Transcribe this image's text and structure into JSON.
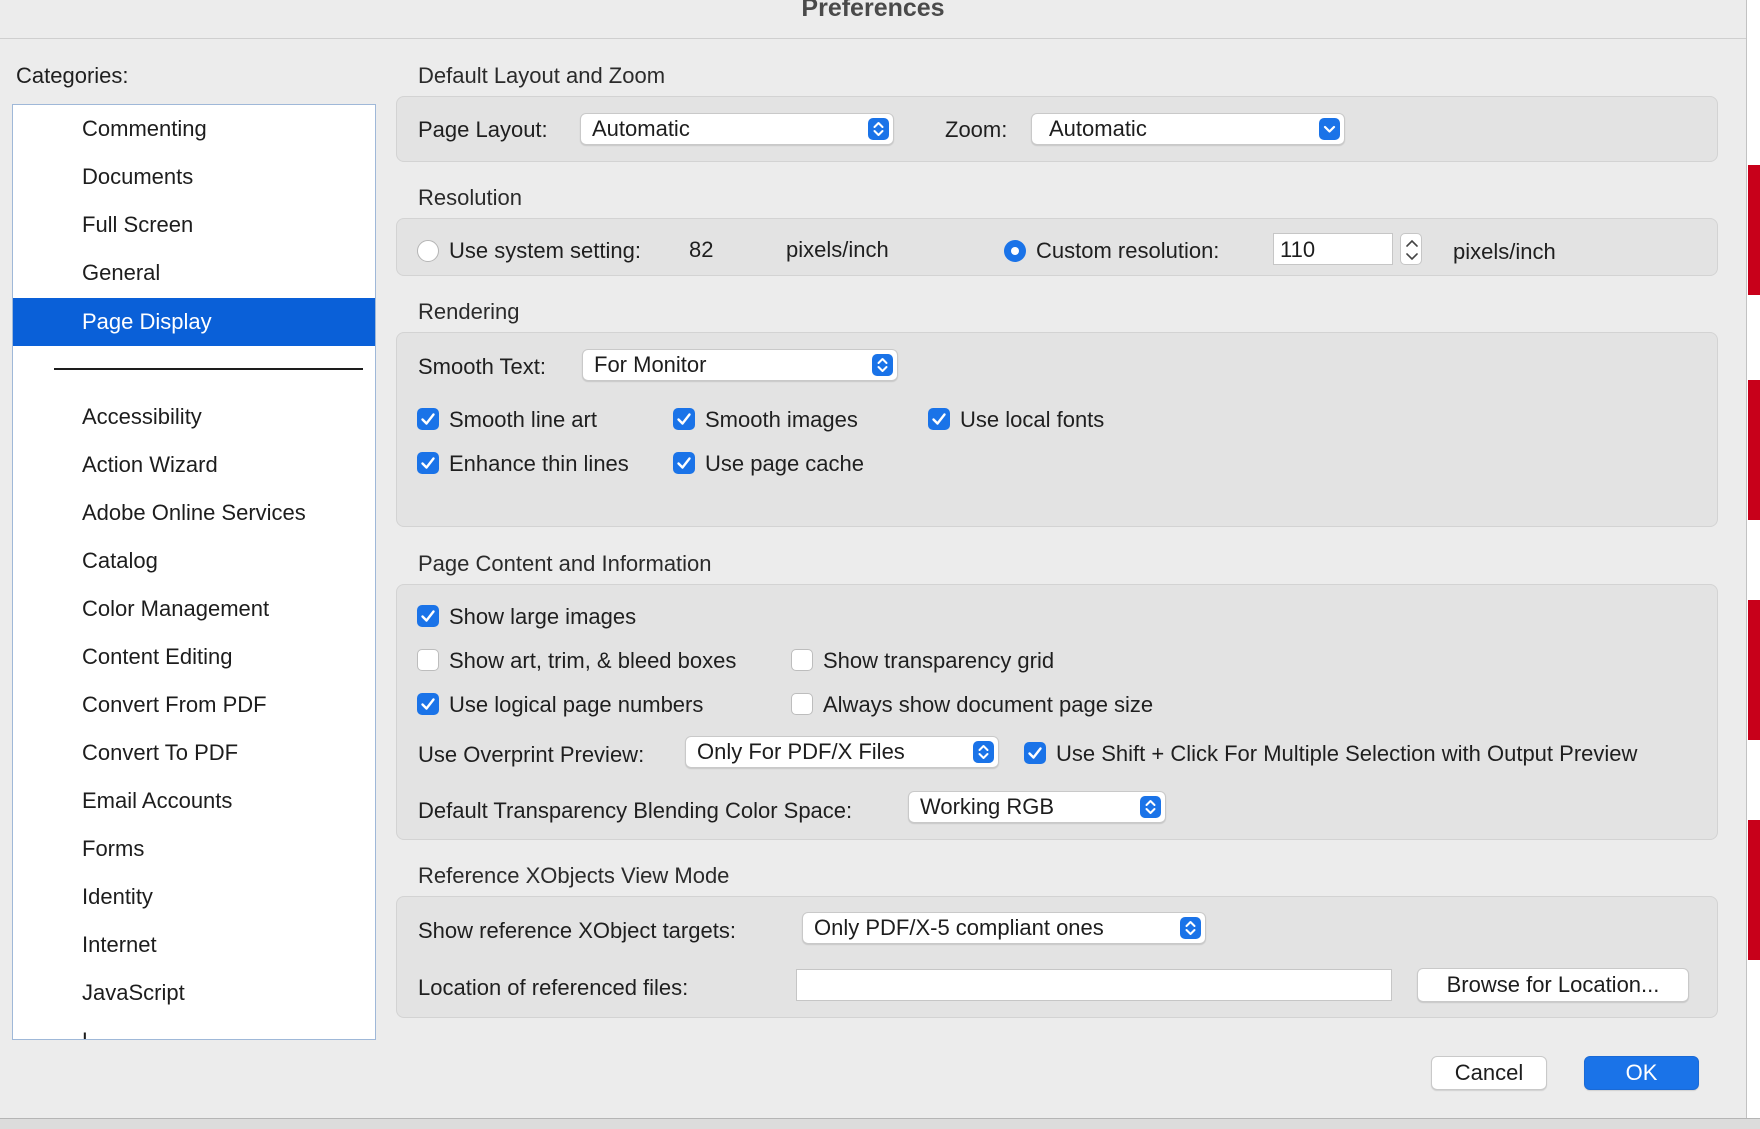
{
  "window": {
    "title": "Preferences"
  },
  "colors": {
    "accent": "#1a73e8",
    "selection": "#0a60d8"
  },
  "categories": {
    "label": "Categories:",
    "top_items": [
      "Commenting",
      "Documents",
      "Full Screen",
      "General",
      "Page Display"
    ],
    "selected": "Page Display",
    "bottom_items": [
      "Accessibility",
      "Action Wizard",
      "Adobe Online Services",
      "Catalog",
      "Color Management",
      "Content Editing",
      "Convert From PDF",
      "Convert To PDF",
      "Email Accounts",
      "Forms",
      "Identity",
      "Internet",
      "JavaScript",
      "L"
    ]
  },
  "layout_zoom": {
    "title": "Default Layout and Zoom",
    "page_layout_label": "Page Layout:",
    "page_layout_value": "Automatic",
    "zoom_label": "Zoom:",
    "zoom_value": "Automatic"
  },
  "resolution": {
    "title": "Resolution",
    "system_label": "Use system setting:",
    "system_value": "82",
    "system_unit": "pixels/inch",
    "custom_label": "Custom resolution:",
    "custom_value": "110",
    "custom_unit": "pixels/inch",
    "selected": "custom"
  },
  "rendering": {
    "title": "Rendering",
    "smooth_text_label": "Smooth Text:",
    "smooth_text_value": "For Monitor",
    "smooth_line_art": "Smooth line art",
    "smooth_images": "Smooth images",
    "use_local_fonts": "Use local fonts",
    "enhance_thin_lines": "Enhance thin lines",
    "use_page_cache": "Use page cache"
  },
  "page_content": {
    "title": "Page Content and Information",
    "show_large_images": "Show large images",
    "show_art_trim": "Show art, trim, & bleed boxes",
    "show_transparency_grid": "Show transparency grid",
    "use_logical_page_numbers": "Use logical page numbers",
    "always_show_doc_size": "Always show document page size",
    "overprint_label": "Use Overprint Preview:",
    "overprint_value": "Only For PDF/X Files",
    "shift_click": "Use Shift + Click For Multiple Selection with Output Preview",
    "blending_label": "Default Transparency Blending Color Space:",
    "blending_value": "Working RGB"
  },
  "xobjects": {
    "title": "Reference XObjects View Mode",
    "targets_label": "Show reference XObject targets:",
    "targets_value": "Only PDF/X-5 compliant ones",
    "location_label": "Location of referenced files:",
    "location_value": "",
    "browse_label": "Browse for Location..."
  },
  "footer": {
    "cancel": "Cancel",
    "ok": "OK"
  }
}
